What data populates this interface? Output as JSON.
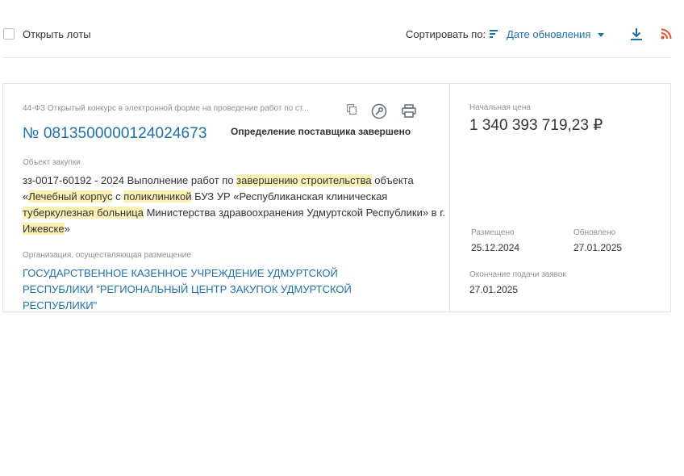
{
  "toolbar": {
    "open_lots_label": "Открыть лоты",
    "sort_label": "Сортировать по:",
    "sort_value": "Дате обновления",
    "icons": {
      "sort": "sort-lines-icon",
      "download": "download-icon",
      "rss": "rss-icon"
    }
  },
  "card": {
    "procurement_type": "44-ФЗ Открытый конкурс в электронной форме на проведение работ по ст...",
    "reg_number": "№ 0813500000124024673",
    "status": "Определение поставщика завершено",
    "object_label": "Объект закупки",
    "object_text": {
      "p1": "зз-0017-60192 - 2024 Выполнение работ по ",
      "h1": "завершению строительства",
      "p2": " объекта «",
      "h2": "Лечебный корпус",
      "p3": " с ",
      "h3": "поликлиникой",
      "p4": " БУЗ УР «Республиканская клиническая ",
      "h4": "туберкулезная больница",
      "p5": " Министерства здравоохранения Удмуртской Республики» в г. ",
      "h5": "Ижевске",
      "p6": "»"
    },
    "org_label": "Организация, осуществляющая размещение",
    "org_name": "ГОСУДАРСТВЕННОЕ КАЗЕННОЕ УЧРЕЖДЕНИЕ УДМУРТСКОЙ РЕСПУБЛИКИ \"РЕГИОНАЛЬНЫЙ ЦЕНТР ЗАКУПОК УДМУРТСКОЙ РЕСПУБЛИКИ\"",
    "price_label": "Начальная цена",
    "price_value": "1 340 393 719,23 ₽",
    "placed_label": "Размещено",
    "placed_value": "25.12.2024",
    "updated_label": "Обновлено",
    "updated_value": "27.01.2025",
    "end_label": "Окончание подачи заявок",
    "end_value": "27.01.2025",
    "icons": {
      "copy": "copy-icon",
      "key": "key-icon",
      "print": "printer-icon"
    }
  },
  "colors": {
    "accent": "#1f6fa8",
    "highlight": "#fcf2b6",
    "rss": "#e0532f",
    "muted": "#8a9099"
  }
}
